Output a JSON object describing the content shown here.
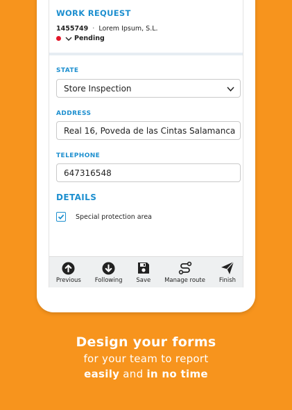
{
  "work_request": {
    "title": "WORK REQUEST",
    "number": "1455749",
    "separator": "·",
    "client": "Lorem Ipsum, S.L.",
    "status": "Pending",
    "status_color": "#e3172a"
  },
  "form": {
    "state_label": "STATE",
    "state_value": "Store Inspection",
    "address_label": "ADDRESS",
    "address_value": "Real 16, Poveda de las Cintas Salamanca",
    "telephone_label": "TELEPHONE",
    "telephone_value": "647316548"
  },
  "details": {
    "title": "DETAILS",
    "checkbox_label": "Special protection area",
    "checkbox_checked": true
  },
  "toolbar": {
    "previous": "Previous",
    "following": "Following",
    "save": "Save",
    "manage_route": "Manage route",
    "finish": "Finish"
  },
  "tagline": {
    "line1": "Design your forms",
    "line2": "for your team to report",
    "line3_a": "easily",
    "line3_b": " and ",
    "line3_c": "in no time"
  },
  "colors": {
    "background": "#F7941D",
    "accent": "#1d8fcf"
  }
}
